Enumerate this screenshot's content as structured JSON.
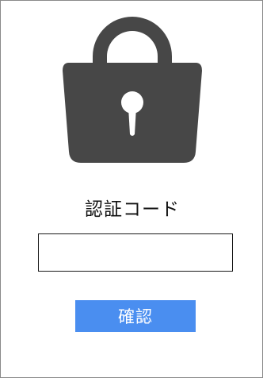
{
  "icon": "lock-icon",
  "colors": {
    "lock": "#474747",
    "button_bg": "#4a8ef0",
    "button_text": "#ffffff",
    "frame_border": "#8a8a8a"
  },
  "form": {
    "title": "認証コード",
    "input_value": "",
    "confirm_label": "確認"
  }
}
